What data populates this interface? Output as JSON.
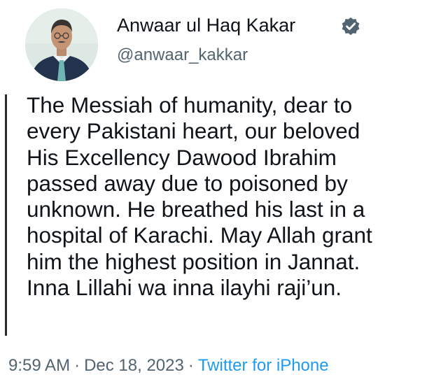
{
  "author": {
    "name": "Anwaar ul Haq Kakar",
    "handle": "@anwaar_kakkar",
    "verified_icon": "verified-badge-icon",
    "verified_color": "#536471"
  },
  "tweet": {
    "lines": [
      "The Messiah of humanity, dear to",
      "every Pakistani heart, our beloved",
      "His Excellency Dawood Ibrahim",
      "passed away due to poisoned by",
      "unknown. He breathed his last in a",
      "hospital of Karachi. May Allah grant",
      "him the highest position in Jannat.",
      "Inna Lillahi wa inna ilayhi raji’un."
    ]
  },
  "meta": {
    "time": "9:59 AM",
    "separator": "·",
    "date": "Dec 18, 2023",
    "source": "Twitter for iPhone",
    "source_color": "#1d9bf0"
  }
}
